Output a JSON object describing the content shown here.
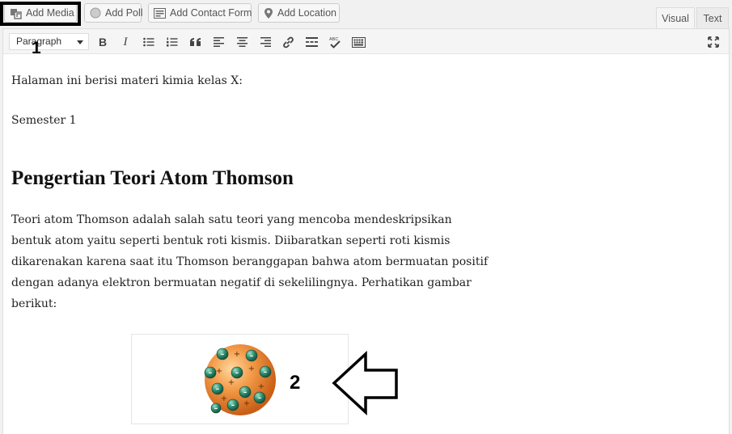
{
  "media_buttons": {
    "add_media": "Add Media",
    "add_poll": "Add Poll",
    "add_contact_form": "Add Contact Form",
    "add_location": "Add Location"
  },
  "tabs": {
    "visual": "Visual",
    "text": "Text",
    "active": "visual"
  },
  "toolbar": {
    "format_select": "Paragraph"
  },
  "annotations": {
    "marker_1": "1",
    "marker_2": "2"
  },
  "content": {
    "intro": "Halaman ini berisi materi kimia kelas X:",
    "semester": "Semester 1",
    "heading": "Pengertian Teori Atom Thomson",
    "paragraph_lines": [
      "Teori atom Thomson adalah salah satu teori yang mencoba mendeskripsikan",
      "bentuk atom yaitu seperti bentuk roti kismis. Diibaratkan seperti roti kismis",
      "dikarenakan karena saat itu Thomson beranggapan bahwa atom bermuatan positif",
      "dengan adanya elektron bermuatan negatif di sekelilingnya. Perhatikan gambar",
      "berikut:"
    ]
  },
  "colors": {
    "highlight_border": "#000000",
    "atom_body": "#f08a3a",
    "electron": "#2e8b6e"
  }
}
